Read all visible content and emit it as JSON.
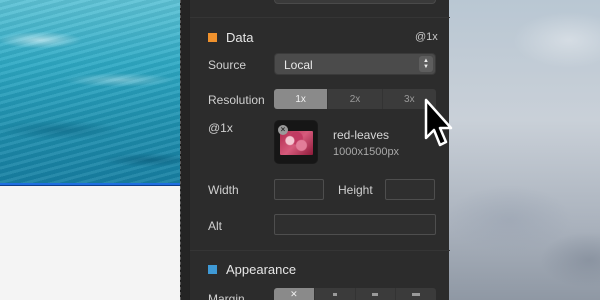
{
  "panel": {
    "data_section": {
      "title": "Data",
      "scale_tag": "@1x",
      "accent_color": "#f0922d",
      "source_label": "Source",
      "source_value": "Local",
      "resolution_label": "Resolution",
      "resolution_options": [
        "1x",
        "2x",
        "3x"
      ],
      "resolution_selected": "1x",
      "image_label": "@1x",
      "image_name": "red-leaves",
      "image_dims": "1000x1500px",
      "width_label": "Width",
      "height_label": "Height",
      "alt_label": "Alt"
    },
    "appearance_section": {
      "title": "Appearance",
      "accent_color": "#3f9ad6",
      "margin_label": "Margin"
    }
  },
  "icons": [
    "remove-image-icon",
    "stepper-icon",
    "mouse-pointer-icon",
    "no-margin-icon"
  ]
}
